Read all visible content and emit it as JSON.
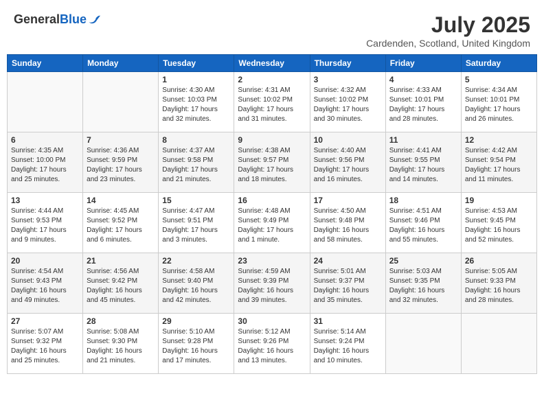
{
  "header": {
    "logo_general": "General",
    "logo_blue": "Blue",
    "month_year": "July 2025",
    "location": "Cardenden, Scotland, United Kingdom"
  },
  "days_of_week": [
    "Sunday",
    "Monday",
    "Tuesday",
    "Wednesday",
    "Thursday",
    "Friday",
    "Saturday"
  ],
  "weeks": [
    [
      {
        "day": "",
        "info": ""
      },
      {
        "day": "",
        "info": ""
      },
      {
        "day": "1",
        "info": "Sunrise: 4:30 AM\nSunset: 10:03 PM\nDaylight: 17 hours\nand 32 minutes."
      },
      {
        "day": "2",
        "info": "Sunrise: 4:31 AM\nSunset: 10:02 PM\nDaylight: 17 hours\nand 31 minutes."
      },
      {
        "day": "3",
        "info": "Sunrise: 4:32 AM\nSunset: 10:02 PM\nDaylight: 17 hours\nand 30 minutes."
      },
      {
        "day": "4",
        "info": "Sunrise: 4:33 AM\nSunset: 10:01 PM\nDaylight: 17 hours\nand 28 minutes."
      },
      {
        "day": "5",
        "info": "Sunrise: 4:34 AM\nSunset: 10:01 PM\nDaylight: 17 hours\nand 26 minutes."
      }
    ],
    [
      {
        "day": "6",
        "info": "Sunrise: 4:35 AM\nSunset: 10:00 PM\nDaylight: 17 hours\nand 25 minutes."
      },
      {
        "day": "7",
        "info": "Sunrise: 4:36 AM\nSunset: 9:59 PM\nDaylight: 17 hours\nand 23 minutes."
      },
      {
        "day": "8",
        "info": "Sunrise: 4:37 AM\nSunset: 9:58 PM\nDaylight: 17 hours\nand 21 minutes."
      },
      {
        "day": "9",
        "info": "Sunrise: 4:38 AM\nSunset: 9:57 PM\nDaylight: 17 hours\nand 18 minutes."
      },
      {
        "day": "10",
        "info": "Sunrise: 4:40 AM\nSunset: 9:56 PM\nDaylight: 17 hours\nand 16 minutes."
      },
      {
        "day": "11",
        "info": "Sunrise: 4:41 AM\nSunset: 9:55 PM\nDaylight: 17 hours\nand 14 minutes."
      },
      {
        "day": "12",
        "info": "Sunrise: 4:42 AM\nSunset: 9:54 PM\nDaylight: 17 hours\nand 11 minutes."
      }
    ],
    [
      {
        "day": "13",
        "info": "Sunrise: 4:44 AM\nSunset: 9:53 PM\nDaylight: 17 hours\nand 9 minutes."
      },
      {
        "day": "14",
        "info": "Sunrise: 4:45 AM\nSunset: 9:52 PM\nDaylight: 17 hours\nand 6 minutes."
      },
      {
        "day": "15",
        "info": "Sunrise: 4:47 AM\nSunset: 9:51 PM\nDaylight: 17 hours\nand 3 minutes."
      },
      {
        "day": "16",
        "info": "Sunrise: 4:48 AM\nSunset: 9:49 PM\nDaylight: 17 hours\nand 1 minute."
      },
      {
        "day": "17",
        "info": "Sunrise: 4:50 AM\nSunset: 9:48 PM\nDaylight: 16 hours\nand 58 minutes."
      },
      {
        "day": "18",
        "info": "Sunrise: 4:51 AM\nSunset: 9:46 PM\nDaylight: 16 hours\nand 55 minutes."
      },
      {
        "day": "19",
        "info": "Sunrise: 4:53 AM\nSunset: 9:45 PM\nDaylight: 16 hours\nand 52 minutes."
      }
    ],
    [
      {
        "day": "20",
        "info": "Sunrise: 4:54 AM\nSunset: 9:43 PM\nDaylight: 16 hours\nand 49 minutes."
      },
      {
        "day": "21",
        "info": "Sunrise: 4:56 AM\nSunset: 9:42 PM\nDaylight: 16 hours\nand 45 minutes."
      },
      {
        "day": "22",
        "info": "Sunrise: 4:58 AM\nSunset: 9:40 PM\nDaylight: 16 hours\nand 42 minutes."
      },
      {
        "day": "23",
        "info": "Sunrise: 4:59 AM\nSunset: 9:39 PM\nDaylight: 16 hours\nand 39 minutes."
      },
      {
        "day": "24",
        "info": "Sunrise: 5:01 AM\nSunset: 9:37 PM\nDaylight: 16 hours\nand 35 minutes."
      },
      {
        "day": "25",
        "info": "Sunrise: 5:03 AM\nSunset: 9:35 PM\nDaylight: 16 hours\nand 32 minutes."
      },
      {
        "day": "26",
        "info": "Sunrise: 5:05 AM\nSunset: 9:33 PM\nDaylight: 16 hours\nand 28 minutes."
      }
    ],
    [
      {
        "day": "27",
        "info": "Sunrise: 5:07 AM\nSunset: 9:32 PM\nDaylight: 16 hours\nand 25 minutes."
      },
      {
        "day": "28",
        "info": "Sunrise: 5:08 AM\nSunset: 9:30 PM\nDaylight: 16 hours\nand 21 minutes."
      },
      {
        "day": "29",
        "info": "Sunrise: 5:10 AM\nSunset: 9:28 PM\nDaylight: 16 hours\nand 17 minutes."
      },
      {
        "day": "30",
        "info": "Sunrise: 5:12 AM\nSunset: 9:26 PM\nDaylight: 16 hours\nand 13 minutes."
      },
      {
        "day": "31",
        "info": "Sunrise: 5:14 AM\nSunset: 9:24 PM\nDaylight: 16 hours\nand 10 minutes."
      },
      {
        "day": "",
        "info": ""
      },
      {
        "day": "",
        "info": ""
      }
    ]
  ]
}
